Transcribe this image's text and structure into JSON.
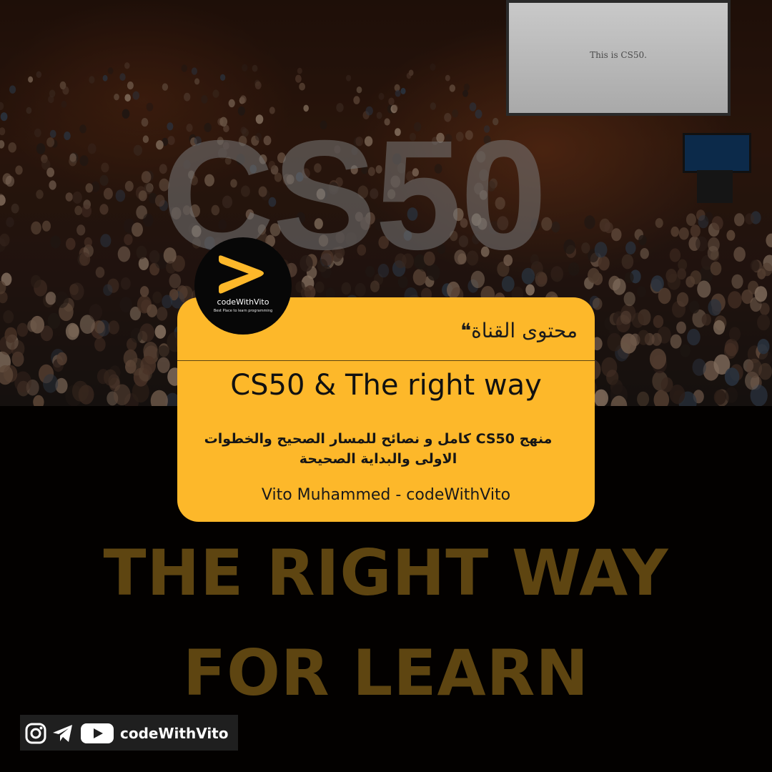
{
  "background": {
    "watermark_text": "CS50",
    "screen_text": "This is CS50."
  },
  "logo": {
    "name": "codeWithVito",
    "tagline": "Best Place to learn programming",
    "accent_color": "#fdb82a",
    "icon": "chevron-right-icon"
  },
  "card": {
    "top_label": "محتوى القناة❝",
    "title": "CS50 & The right way",
    "description": "منهج CS50 كامل و نصائح للمسار الصحيح والخطوات الاولى والبداية الصحيحة",
    "author": "Vito Muhammed - codeWithVito",
    "color": "#fdb82a"
  },
  "headline": {
    "line1": "THE RIGHT WAY",
    "line2": "FOR LEARN",
    "color": "#5e4511"
  },
  "social": {
    "icons": [
      "instagram-icon",
      "telegram-icon",
      "youtube-icon"
    ],
    "handle": "codeWithVito"
  }
}
